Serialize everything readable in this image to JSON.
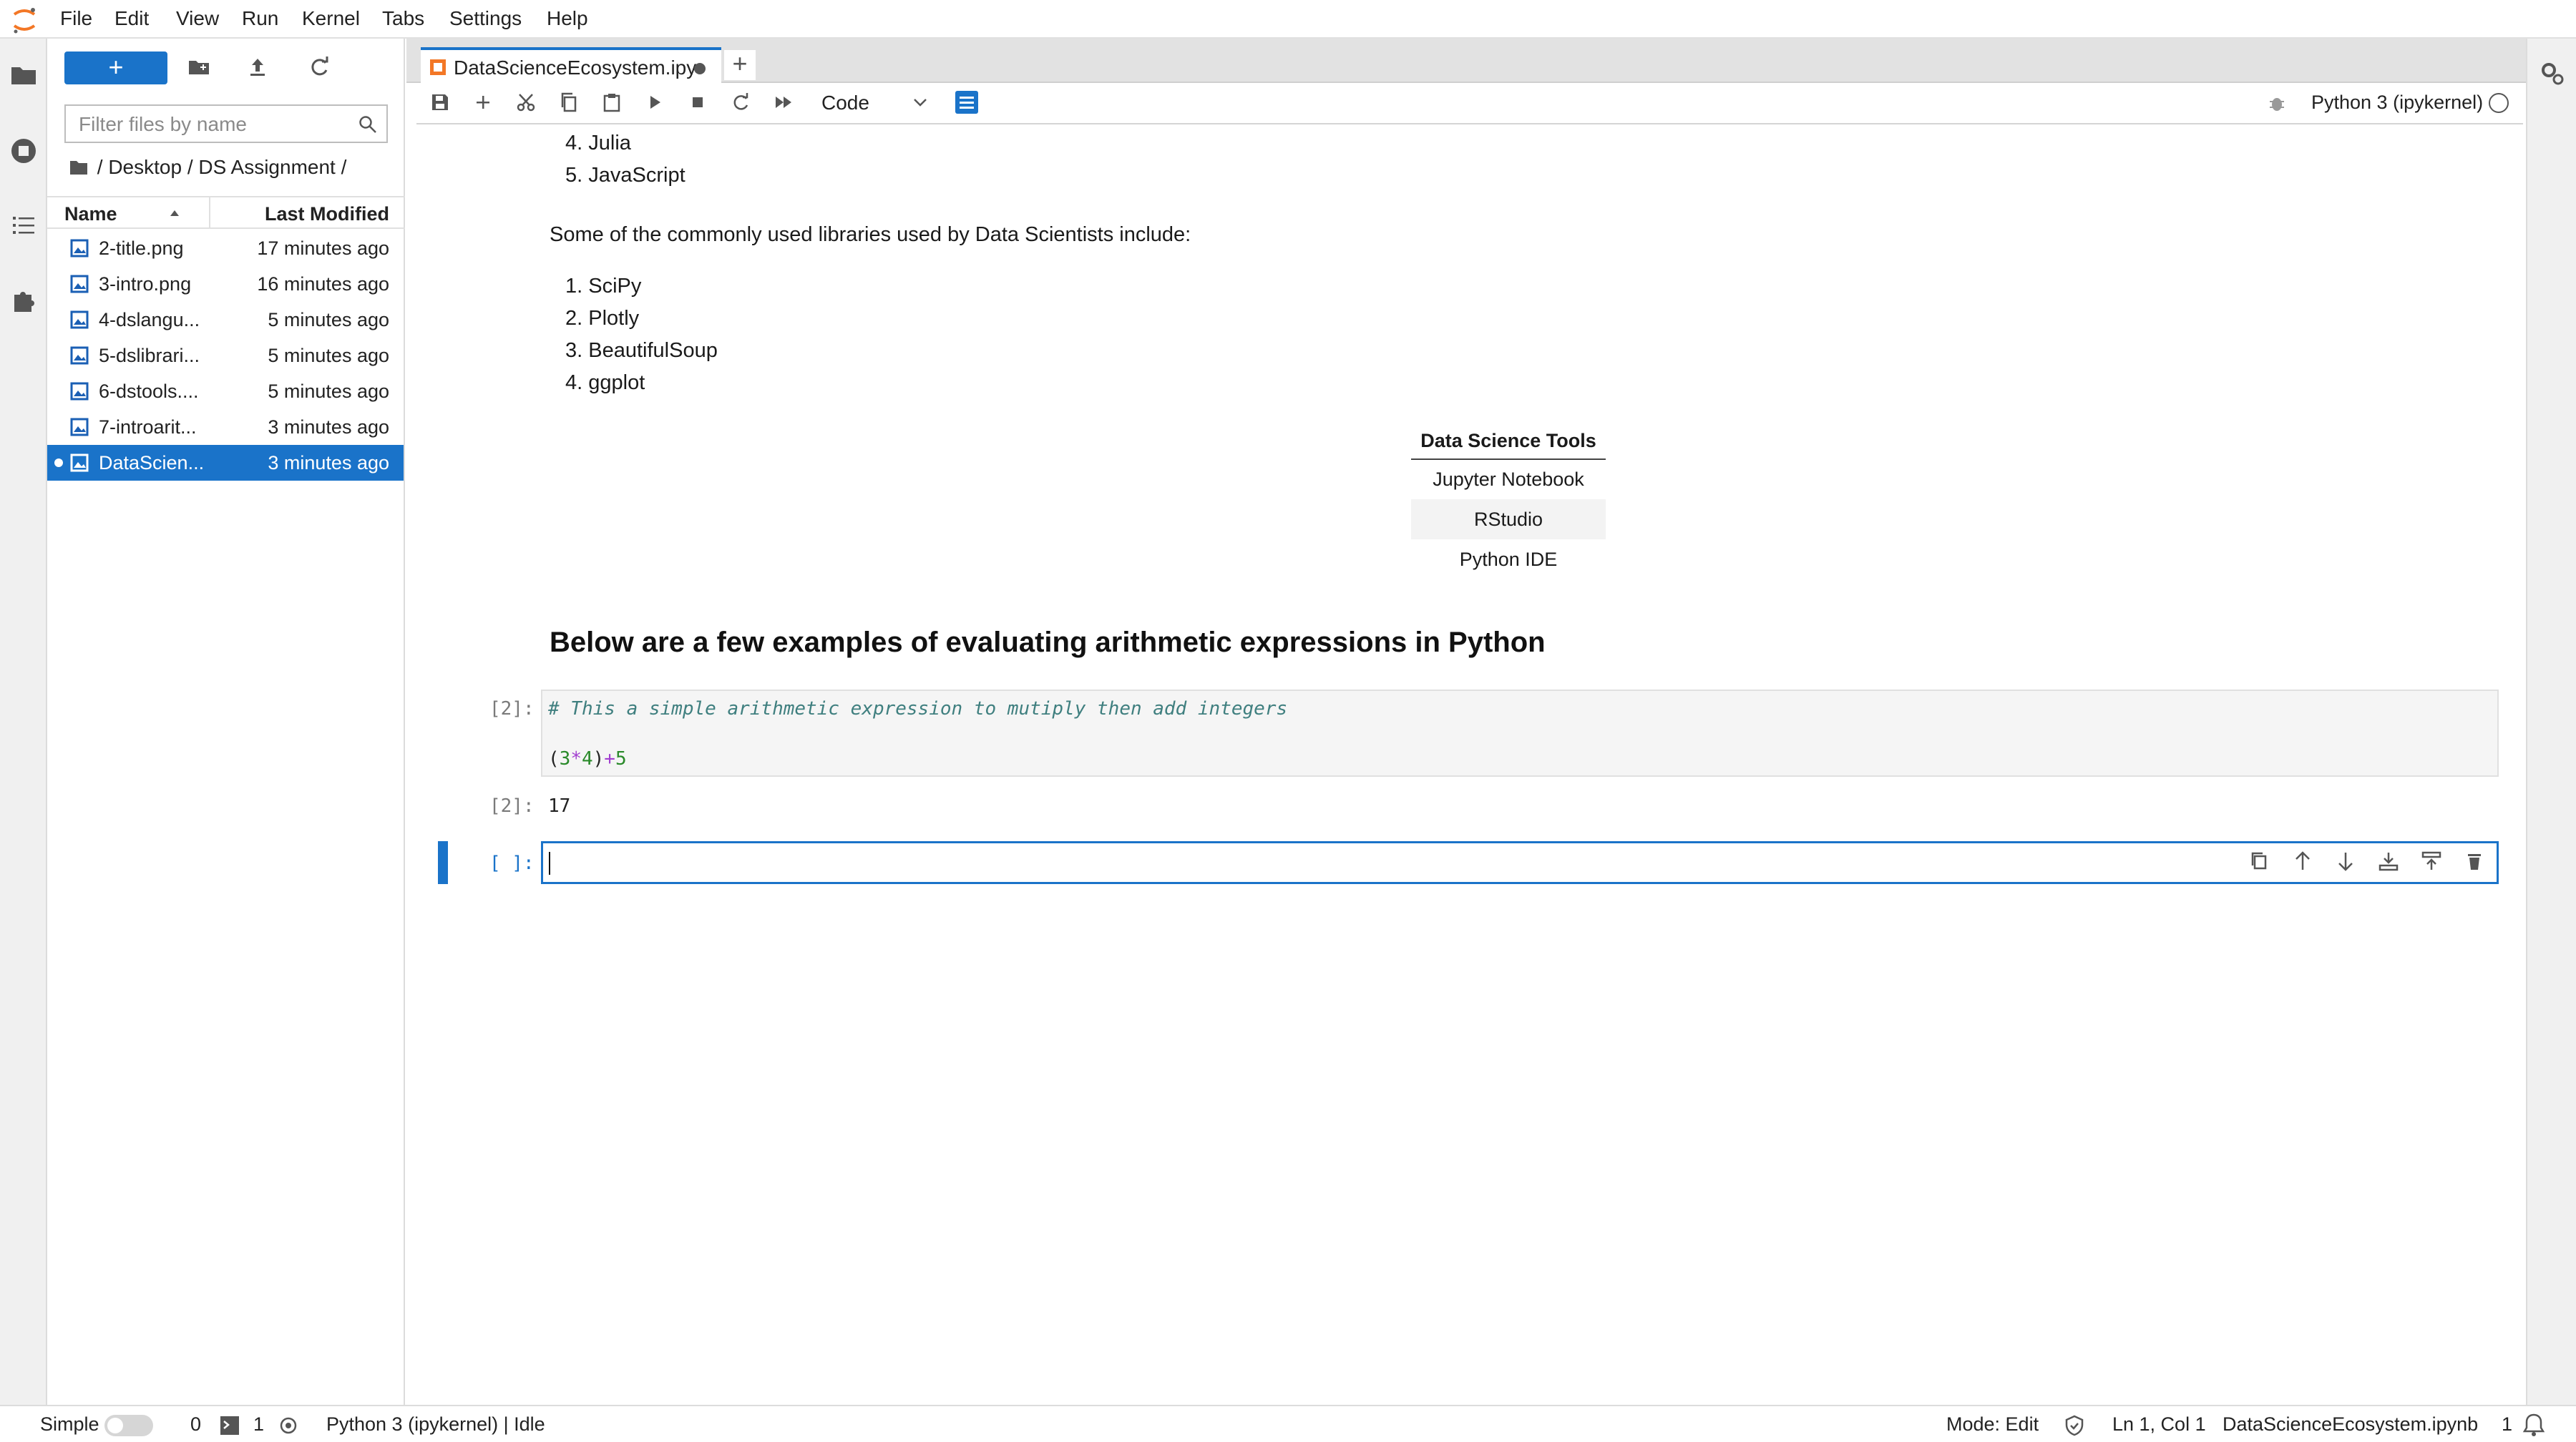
{
  "menubar": {
    "items": [
      "File",
      "Edit",
      "View",
      "Run",
      "Kernel",
      "Tabs",
      "Settings",
      "Help"
    ]
  },
  "filebrowser": {
    "new_label": "+",
    "filter_placeholder": "Filter files by name",
    "breadcrumb": "/ Desktop / DS Assignment /",
    "col_name": "Name",
    "col_modified": "Last Modified",
    "files": [
      {
        "name": "2-title.png",
        "modified": "17 minutes ago"
      },
      {
        "name": "3-intro.png",
        "modified": "16 minutes ago"
      },
      {
        "name": "4-dslangu...",
        "modified": "5 minutes ago"
      },
      {
        "name": "5-dslibrari...",
        "modified": "5 minutes ago"
      },
      {
        "name": "6-dstools....",
        "modified": "5 minutes ago"
      },
      {
        "name": "7-introarit...",
        "modified": "3 minutes ago"
      },
      {
        "name": "DataScien...",
        "modified": "3 minutes ago"
      }
    ]
  },
  "tab": {
    "title": "DataScienceEcosystem.ipy",
    "add_label": "+"
  },
  "toolbar": {
    "cell_type": "Code",
    "kernel": "Python 3 (ipykernel)"
  },
  "notebook": {
    "lang_items": [
      "4. Julia",
      "5. JavaScript"
    ],
    "libraries_intro": "Some of the commonly used libraries used by Data Scientists include:",
    "libraries": [
      "1. SciPy",
      "2. Plotly",
      "3. BeautifulSoup",
      "4. ggplot"
    ],
    "table": {
      "header": "Data Science Tools",
      "rows": [
        "Jupyter Notebook",
        "RStudio",
        "Python IDE"
      ]
    },
    "heading": "Below are a few examples of evaluating arithmetic expressions in Python",
    "code_prompt": "[2]:",
    "code_comment": "# This a simple arithmetic expression to mutiply then add integers",
    "code_expr": {
      "p1": "(",
      "n1": "3",
      "op1": "*",
      "n2": "4",
      "p2": ")",
      "op2": "+",
      "n3": "5"
    },
    "output_prompt": "[2]:",
    "output": "17",
    "empty_prompt": "[ ]:"
  },
  "statusbar": {
    "mode_simple": "Simple",
    "count_zero": "0",
    "count_terminals": "1",
    "kernel_status": "Python 3 (ipykernel) | Idle",
    "mode": "Mode: Edit",
    "cursor": "Ln 1, Col 1",
    "filename": "DataScienceEcosystem.ipynb",
    "notifications": "1"
  },
  "colors": {
    "accent": "#1a73c9",
    "code_comment": "#3f7f7f",
    "code_number": "#2a8a2a",
    "code_operator": "#a23fd0"
  }
}
